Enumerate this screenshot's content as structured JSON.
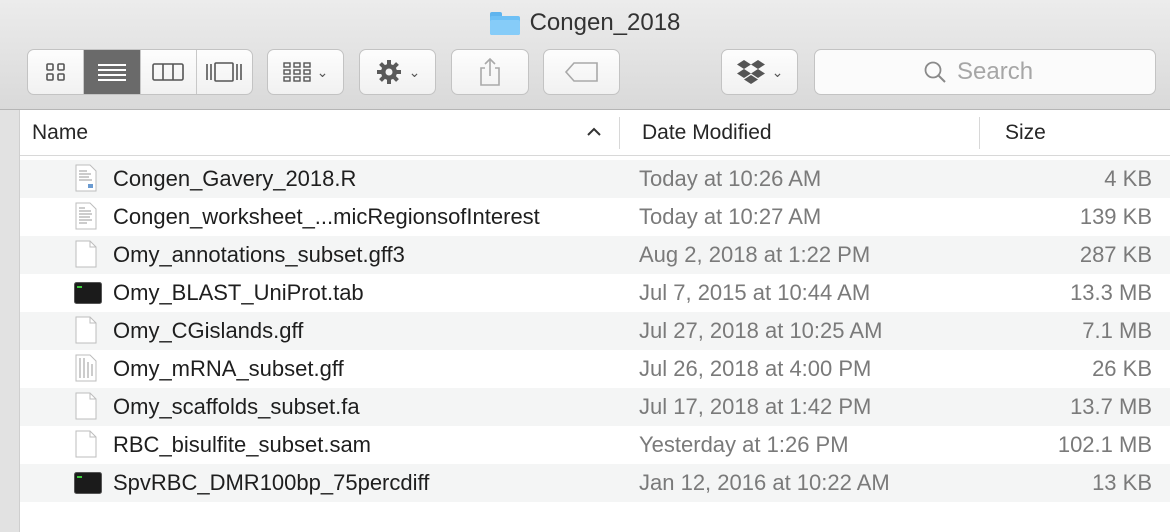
{
  "window": {
    "title": "Congen_2018"
  },
  "toolbar": {
    "view_modes": [
      "icon-view",
      "list-view",
      "column-view",
      "cover-flow-view"
    ],
    "active_view": "list-view",
    "search_placeholder": "Search"
  },
  "columns": {
    "name": "Name",
    "date": "Date Modified",
    "size": "Size"
  },
  "files": [
    {
      "name": "Congen_Gavery_2018.R",
      "date": "Today at 10:26 AM",
      "size": "4 KB",
      "icon": "r-script-icon"
    },
    {
      "name": "Congen_worksheet_...micRegionsofInterest",
      "date": "Today at 10:27 AM",
      "size": "139 KB",
      "icon": "document-preview-icon"
    },
    {
      "name": "Omy_annotations_subset.gff3",
      "date": "Aug 2, 2018 at 1:22 PM",
      "size": "287 KB",
      "icon": "blank-document-icon"
    },
    {
      "name": "Omy_BLAST_UniProt.tab",
      "date": "Jul 7, 2015 at 10:44 AM",
      "size": "13.3 MB",
      "icon": "terminal-icon"
    },
    {
      "name": "Omy_CGislands.gff",
      "date": "Jul 27, 2018 at 10:25 AM",
      "size": "7.1 MB",
      "icon": "blank-document-icon"
    },
    {
      "name": "Omy_mRNA_subset.gff",
      "date": "Jul 26, 2018 at 4:00 PM",
      "size": "26 KB",
      "icon": "text-document-icon"
    },
    {
      "name": "Omy_scaffolds_subset.fa",
      "date": "Jul 17, 2018 at 1:42 PM",
      "size": "13.7 MB",
      "icon": "blank-document-icon"
    },
    {
      "name": "RBC_bisulfite_subset.sam",
      "date": "Yesterday at 1:26 PM",
      "size": "102.1 MB",
      "icon": "blank-document-icon"
    },
    {
      "name": "SpvRBC_DMR100bp_75percdiff",
      "date": "Jan 12, 2016 at 10:22 AM",
      "size": "13 KB",
      "icon": "terminal-icon"
    }
  ],
  "colors": {
    "folder": "#6ec0f5",
    "active_view": "#6a6a6a",
    "row_alt": "#f4f5f5"
  }
}
